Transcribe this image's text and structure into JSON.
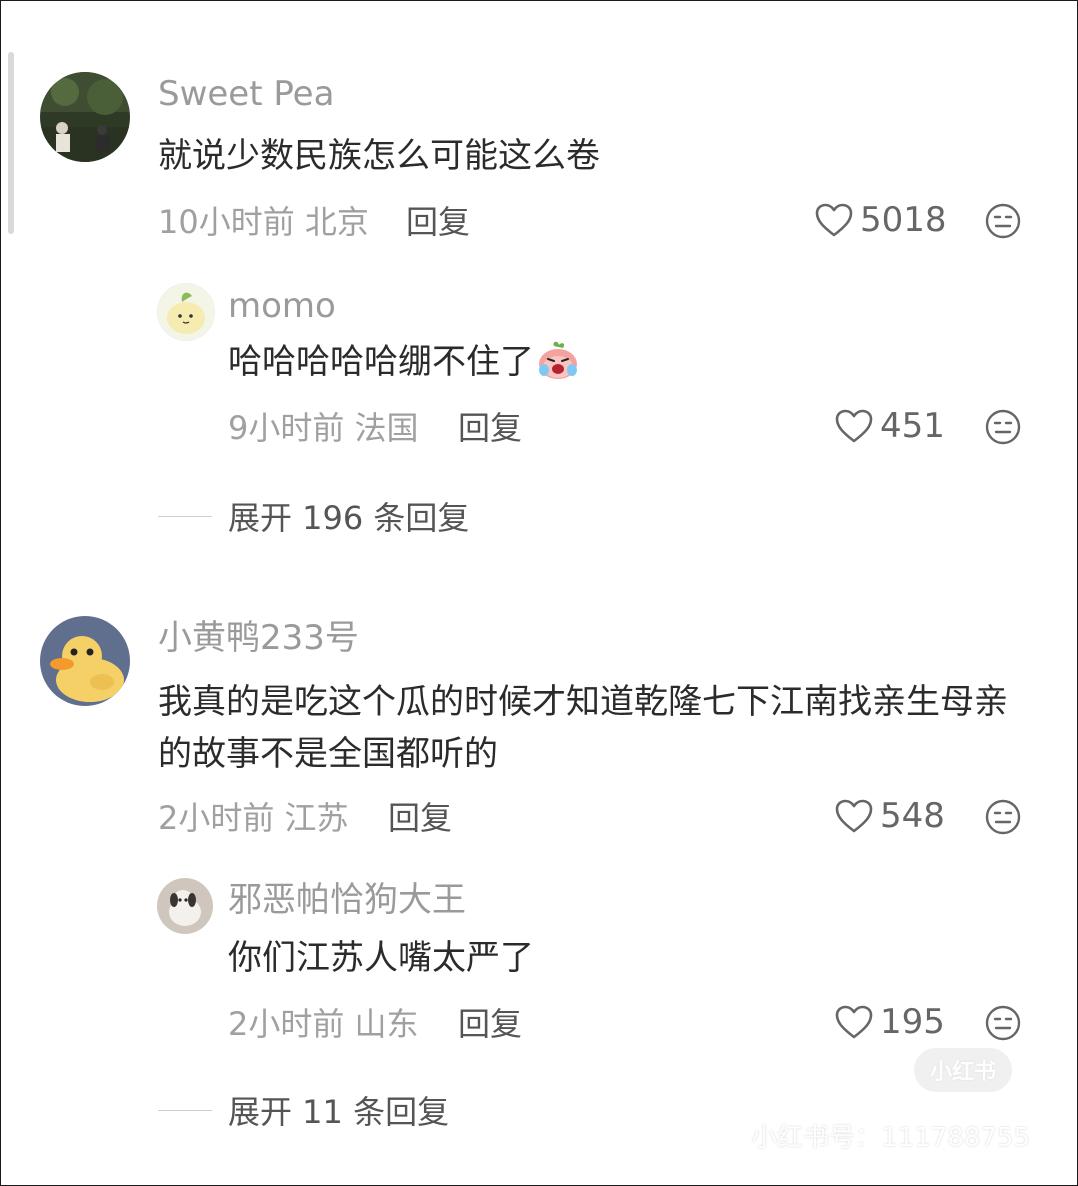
{
  "comments": [
    {
      "user": "Sweet Pea",
      "text": "就说少数民族怎么可能这么卷",
      "time_location": "10小时前 北京",
      "reply_label": "回复",
      "likes": "5018",
      "replies": [
        {
          "user": "momo",
          "text": "哈哈哈哈哈绷不住了",
          "time_location": "9小时前 法国",
          "reply_label": "回复",
          "likes": "451"
        }
      ],
      "expand_label": "展开 196 条回复"
    },
    {
      "user": "小黄鸭233号",
      "text": "我真的是吃这个瓜的时候才知道乾隆七下江南找亲生母亲的故事不是全国都听的",
      "time_location": "2小时前 江苏",
      "reply_label": "回复",
      "likes": "548",
      "replies": [
        {
          "user": "邪恶帕恰狗大王",
          "text": "你们江苏人嘴太严了",
          "time_location": "2小时前 山东",
          "reply_label": "回复",
          "likes": "195"
        }
      ],
      "expand_label": "展开 11 条回复"
    }
  ],
  "watermark": {
    "badge": "小红书",
    "id_text": "小红书号：111788755"
  },
  "icons": {
    "like": "heart-outline-icon",
    "dislike": "neutral-face-icon",
    "reply_emoji": "crying-laughing-emoji"
  },
  "colors": {
    "name": "#9a9a9a",
    "text": "#2b2b2b",
    "meta": "#a0a0a0"
  }
}
